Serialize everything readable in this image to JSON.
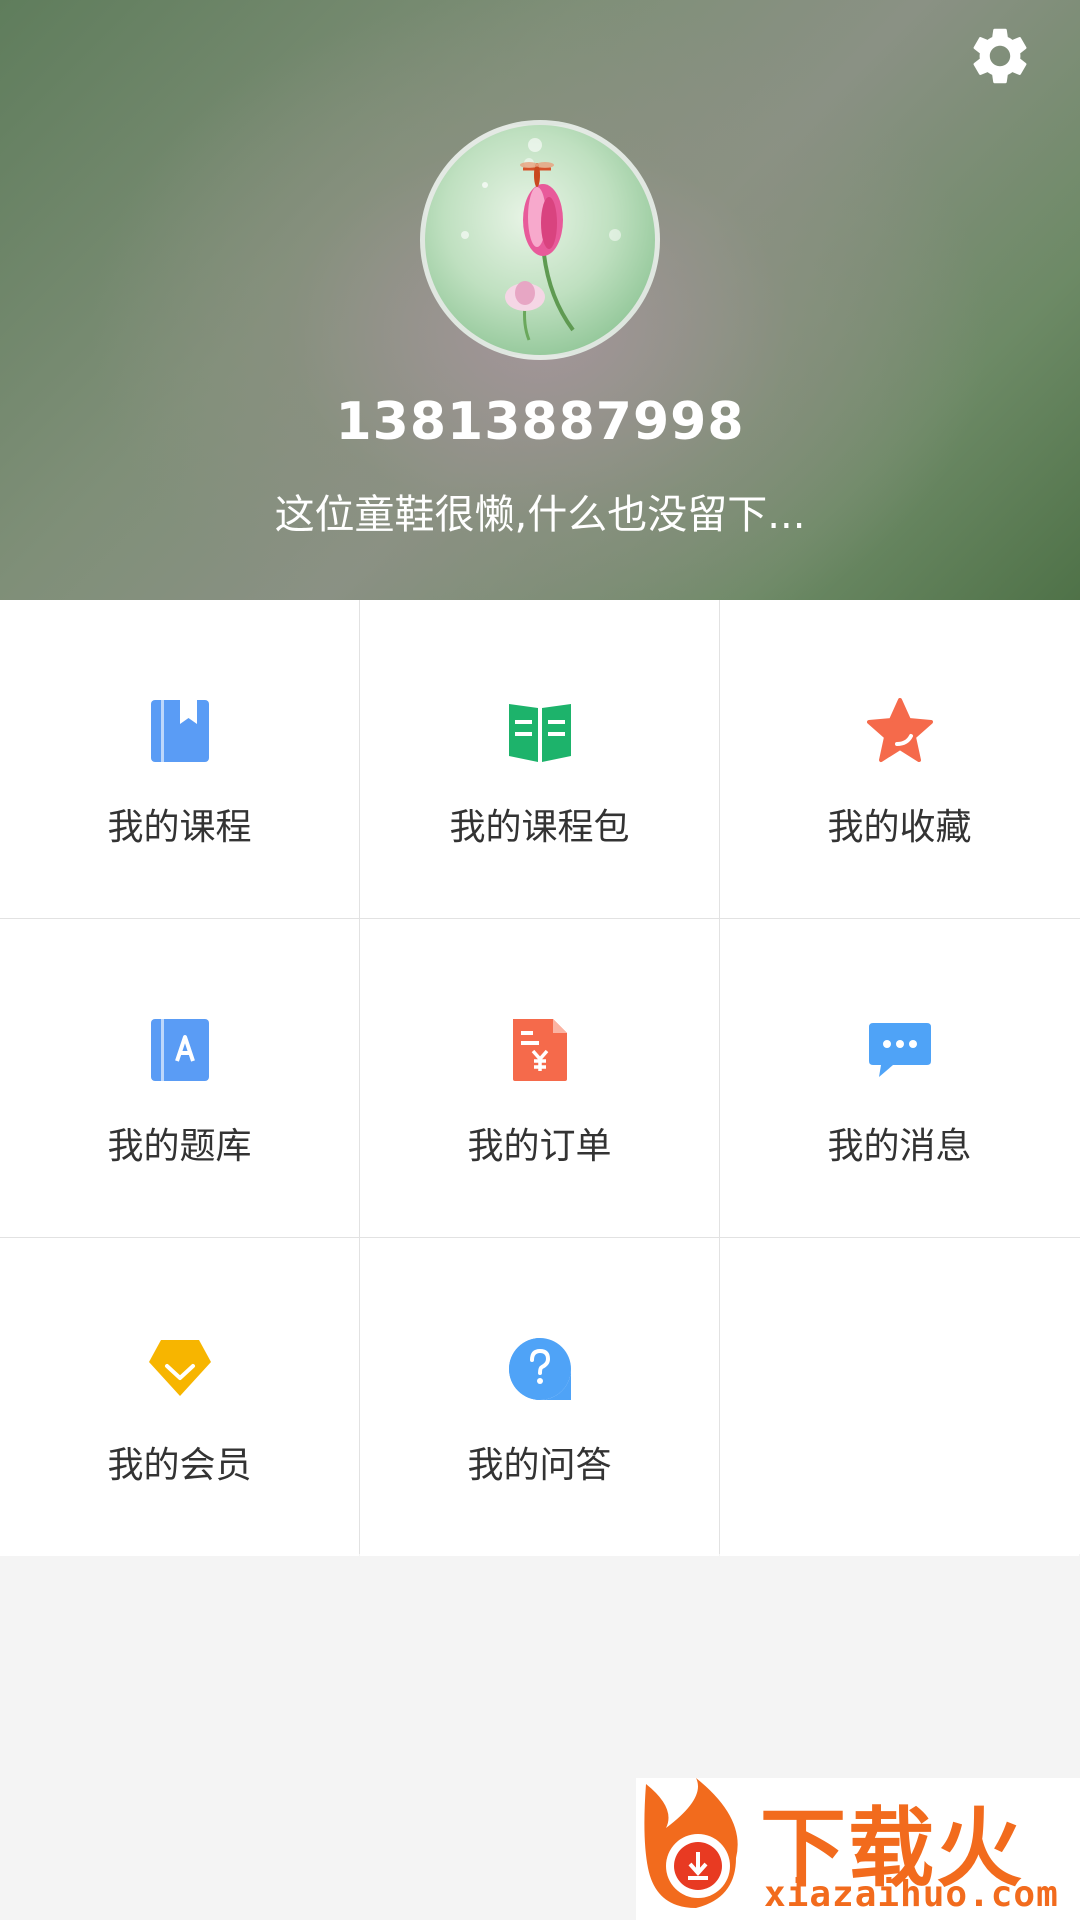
{
  "profile": {
    "phone": "13813887998",
    "bio": "这位童鞋很懒,什么也没留下..."
  },
  "header": {
    "settings_icon": "gear-icon"
  },
  "menu": [
    {
      "label": "我的课程",
      "icon": "book-icon",
      "color": "#5a9cf5"
    },
    {
      "label": "我的课程包",
      "icon": "open-book-icon",
      "color": "#1db36b"
    },
    {
      "label": "我的收藏",
      "icon": "star-icon",
      "color": "#f56a4b"
    },
    {
      "label": "我的题库",
      "icon": "question-bank-icon",
      "color": "#5a9cf5"
    },
    {
      "label": "我的订单",
      "icon": "order-icon",
      "color": "#f56a4b"
    },
    {
      "label": "我的消息",
      "icon": "message-icon",
      "color": "#4fa3f7"
    },
    {
      "label": "我的会员",
      "icon": "vip-icon",
      "color": "#f7b500"
    },
    {
      "label": "我的问答",
      "icon": "question-icon",
      "color": "#4fa3f7"
    }
  ],
  "watermark": {
    "text": "下载火",
    "url": "xiazaihuo.com"
  }
}
